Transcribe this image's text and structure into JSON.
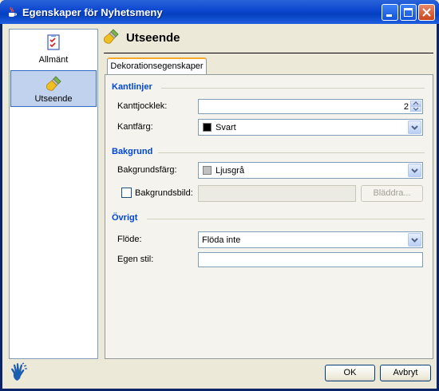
{
  "window": {
    "title": "Egenskaper för Nyhetsmeny"
  },
  "sidebar": {
    "items": [
      {
        "label": "Allmänt",
        "icon": "checklist-icon",
        "selected": false
      },
      {
        "label": "Utseende",
        "icon": "paintbrush-icon",
        "selected": true
      }
    ]
  },
  "content": {
    "title": "Utseende",
    "tabs": [
      {
        "label": "Dekorationsegenskaper",
        "selected": true
      }
    ]
  },
  "sections": {
    "borders": {
      "title": "Kantlinjer",
      "thickness_label": "Kanttjocklek:",
      "thickness_value": "2",
      "color_label": "Kantfärg:",
      "color_value": "Svart",
      "color_swatch": "#000000"
    },
    "background": {
      "title": "Bakgrund",
      "color_label": "Bakgrundsfärg:",
      "color_value": "Ljusgrå",
      "color_swatch": "#c0c0c0",
      "image_label": "Bakgrundsbild:",
      "image_checked": false,
      "image_value": "",
      "browse_label": "Bläddra..."
    },
    "other": {
      "title": "Övrigt",
      "flow_label": "Flöde:",
      "flow_value": "Flöda inte",
      "style_label": "Egen stil:",
      "style_value": ""
    }
  },
  "footer": {
    "ok_label": "OK",
    "cancel_label": "Avbryt",
    "help_icon": "hand-logo-icon"
  },
  "colors": {
    "titlebar": "#0b46cf",
    "section_title": "#0046d5",
    "tab_accent": "#f7a929",
    "selection": "#c1d2ee"
  }
}
